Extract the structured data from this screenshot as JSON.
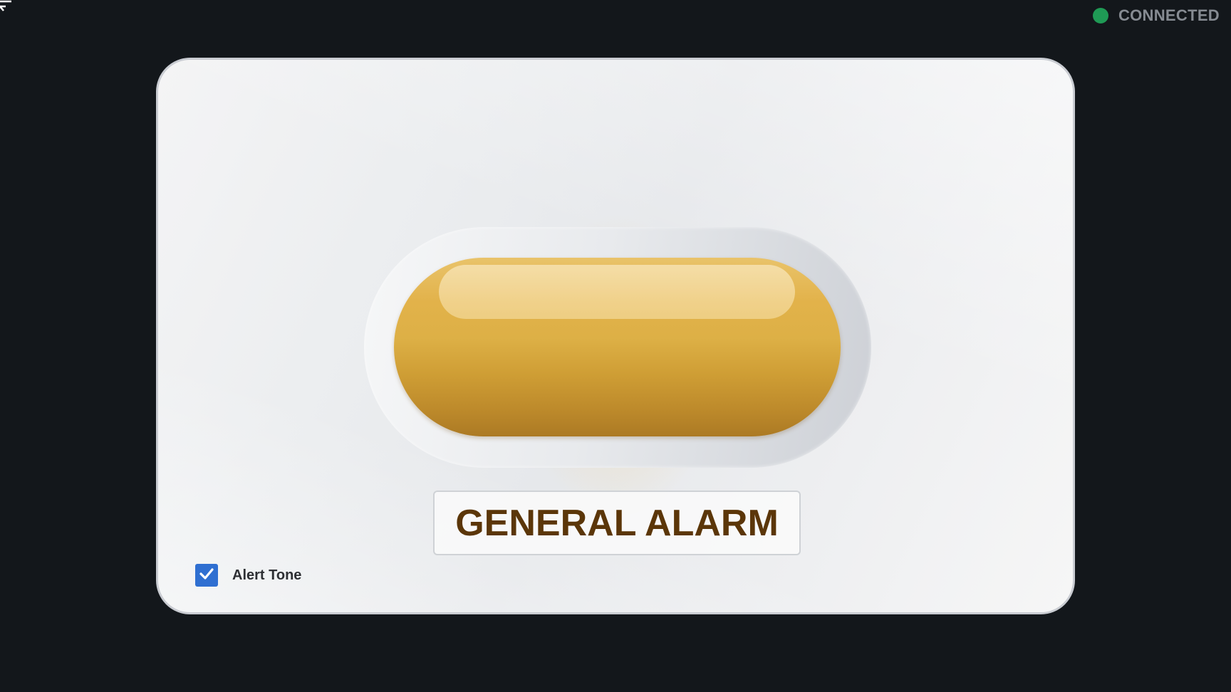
{
  "status": {
    "text": "CONNECTED",
    "dot_color": "#1f9a55"
  },
  "alarm": {
    "label": "GENERAL ALARM",
    "button_color": "#ddb046"
  },
  "alert_tone": {
    "label": "Alert Tone",
    "checked": true,
    "checkbox_color": "#2f6fd1"
  },
  "icons": {
    "menu": "menu-icon",
    "status": "status-dot-icon",
    "check": "check-icon"
  }
}
